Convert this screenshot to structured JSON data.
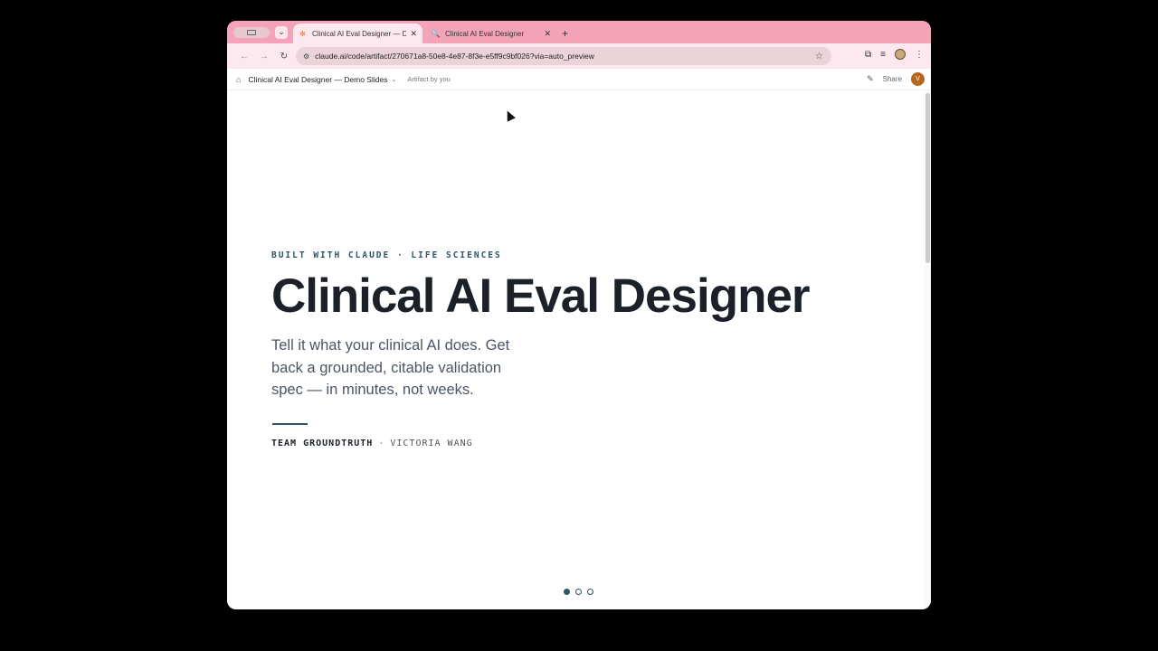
{
  "browser": {
    "tabs": [
      {
        "title": "Clinical AI Eval Designer — De",
        "favicon": "claude-icon",
        "active": true
      },
      {
        "title": "Clinical AI Eval Designer",
        "favicon": "search-icon",
        "active": false
      }
    ],
    "new_tab_label": "+",
    "url": "claude.ai/code/artifact/270671a8-50e8-4e87-8f3e-e5ff9c9bf026?via=auto_preview"
  },
  "artifact_header": {
    "title": "Clinical AI Eval Designer — Demo Slides",
    "byline": "Artifact by you",
    "share_label": "Share",
    "avatar_initial": "V"
  },
  "slide": {
    "eyebrow": "BUILT WITH CLAUDE · LIFE SCIENCES",
    "title": "Clinical AI Eval Designer",
    "subtitle": "Tell it what your clinical AI does. Get back a grounded, citable validation spec — in minutes, not weeks.",
    "team": "TEAM GROUNDTRUTH",
    "separator": "·",
    "author": "VICTORIA WANG"
  },
  "pagination": {
    "total": 3,
    "current": 1
  },
  "colors": {
    "accent": "#2e5467",
    "tab_strip": "#f4a3b8",
    "avatar": "#b8661f"
  }
}
